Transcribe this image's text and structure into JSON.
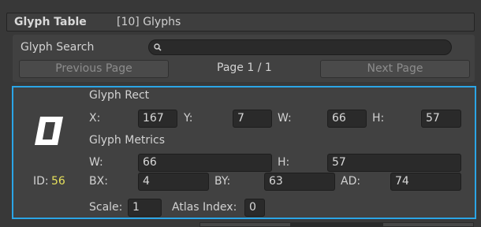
{
  "header": {
    "title": "Glyph Table",
    "count": "[10] Glyphs"
  },
  "search": {
    "label": "Glyph Search",
    "value": "",
    "icon": "search-icon"
  },
  "pagination": {
    "previous_label": "Previous Page",
    "page_text": "Page 1 / 1",
    "next_label": "Next Page"
  },
  "glyph": {
    "id_label": "ID:",
    "id_value": "56",
    "rect": {
      "section_label": "Glyph Rect",
      "x_label": "X:",
      "x_value": "167",
      "y_label": "Y:",
      "y_value": "7",
      "w_label": "W:",
      "w_value": "66",
      "h_label": "H:",
      "h_value": "57"
    },
    "metrics": {
      "section_label": "Glyph Metrics",
      "w_label": "W:",
      "w_value": "66",
      "h_label": "H:",
      "h_value": "57",
      "bx_label": "BX:",
      "bx_value": "4",
      "by_label": "BY:",
      "by_value": "63",
      "ad_label": "AD:",
      "ad_value": "74"
    },
    "scale_label": "Scale:",
    "scale_value": "1",
    "atlas_label": "Atlas Index:",
    "atlas_value": "0"
  },
  "colors": {
    "selection_border": "#2ba5e6",
    "id_value": "#e6e05c",
    "background": "#383838"
  }
}
